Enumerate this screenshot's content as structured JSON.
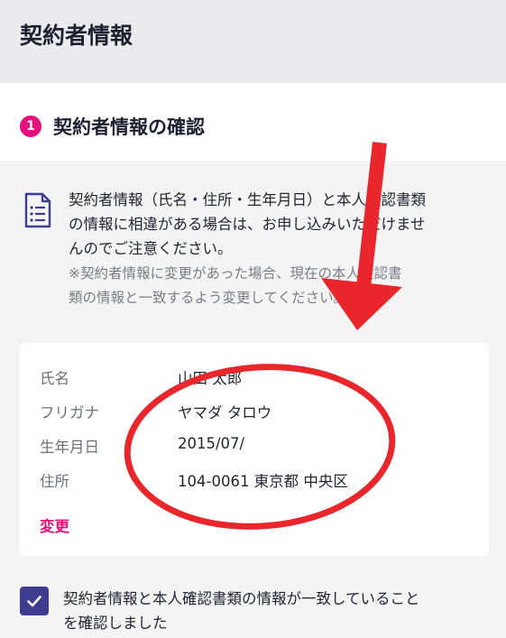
{
  "header": {
    "title": "契約者情報"
  },
  "section": {
    "step": "1",
    "title": "契約者情報の確認"
  },
  "notice": {
    "icon": "document-list-icon",
    "lines": [
      "契約者情報（氏名・住所・生年月日）と本人確認書類",
      "の情報に相違がある場合は、お申し込みいただけませ",
      "んのでご注意ください。"
    ],
    "sub_lines": [
      "※契約者情報に変更があった場合、現在の本人確認書",
      "類の情報と一致するよう変更してください。"
    ]
  },
  "info": {
    "rows": [
      {
        "label": "氏名",
        "value": "山田 太郎"
      },
      {
        "label": "フリガナ",
        "value": "ヤマダ タロウ"
      },
      {
        "label": "生年月日",
        "value": "2015/07/"
      },
      {
        "label": "住所",
        "value": "104-0061 東京都 中央区"
      }
    ],
    "edit_label": "変更"
  },
  "confirm": {
    "checked": true,
    "lines": [
      "契約者情報と本人確認書類の情報が一致していること",
      "を確認しました"
    ]
  },
  "colors": {
    "accent": "#e3127b",
    "checkbox": "#3d3c8e",
    "annotation": "#e8262b"
  }
}
